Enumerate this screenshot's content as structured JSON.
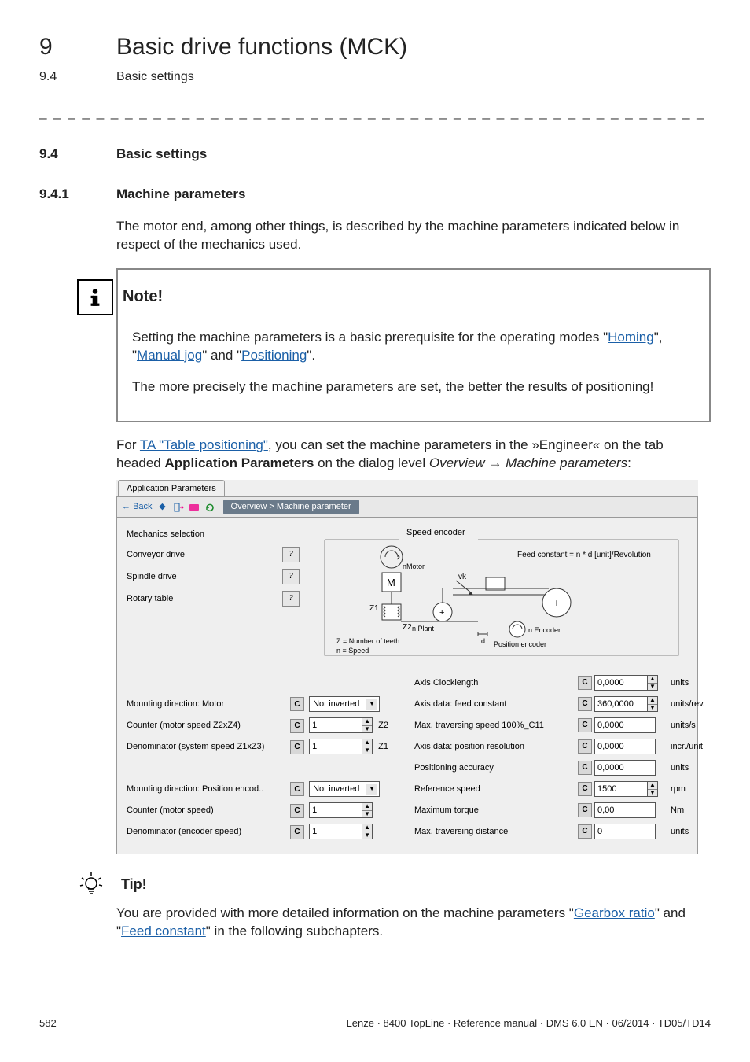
{
  "chapter": {
    "num": "9",
    "title": "Basic drive functions (MCK)"
  },
  "sub": {
    "num": "9.4",
    "title": "Basic settings"
  },
  "dash": "_ _ _ _ _ _ _ _ _ _ _ _ _ _ _ _ _ _ _ _ _ _ _ _ _ _ _ _ _ _ _ _ _ _ _ _ _ _ _ _ _ _ _ _ _ _ _ _ _ _ _ _ _ _ _ _ _ _ _ _ _ _ _ _",
  "sec94": {
    "num": "9.4",
    "title": "Basic settings"
  },
  "sec941": {
    "num": "9.4.1",
    "title": "Machine parameters"
  },
  "intro": "The motor end, among other things, is described by the machine parameters indicated below in respect of the mechanics used.",
  "note": {
    "title": "Note!",
    "line1a": "Setting the machine parameters is a basic prerequisite for the operating modes \"",
    "homing": "Homing",
    "line1b": "\", \"",
    "manualjog": "Manual jog",
    "line1c": "\" and \"",
    "positioning": "Positioning",
    "line1d": "\".",
    "line2": "The more precisely the machine parameters are set, the better the results of positioning!"
  },
  "paraFor_a": "For ",
  "paraFor_link": "TA \"Table positioning\"",
  "paraFor_b": ", you can set the machine parameters in the »Engineer« on the tab headed ",
  "paraFor_bold": "Application Parameters",
  "paraFor_c": " on the dialog level ",
  "paraFor_it1": "Overview",
  "paraFor_arrow": " → ",
  "paraFor_it2": "Machine parameters",
  "paraFor_d": ":",
  "ss": {
    "tab": "Application Parameters",
    "back": "Back",
    "breadcrumb": "Overview > Machine parameter",
    "mech": {
      "heading": "Mechanics selection",
      "conveyor": "Conveyor drive",
      "spindle": "Spindle drive",
      "rotary": "Rotary table",
      "q": "?"
    },
    "diag": {
      "title": "Speed encoder",
      "feed": "Feed constant = n * d [unit]/Revolution",
      "nMotor": "nMotor",
      "nPlant": "n Plant",
      "nEncoder": "n Encoder",
      "Z1": "Z1",
      "Z2": "Z2",
      "vk": "vk",
      "d": "d",
      "zteeth": "Z = Number of teeth",
      "nspeed": "n = Speed",
      "posenc": "Position encoder",
      "M": "M"
    },
    "leftRows": {
      "mdMotor": "Mounting direction: Motor",
      "counterMotor": "Counter (motor speed Z2xZ4)",
      "denomSystem": "Denominator (system speed Z1xZ3)",
      "mdPosEnc": "Mounting direction: Position encod..",
      "counterMotor2": "Counter (motor speed)",
      "denomEnc": "Denominator (encoder speed)",
      "notInverted": "Not inverted",
      "one": "1",
      "Z2": "Z2",
      "Z1": "Z1"
    },
    "rightRows": {
      "axisClocklength": "Axis Clocklength",
      "axisFeed": "Axis data: feed constant",
      "maxTrav100": "Max. traversing speed 100%_C11",
      "axisPosRes": "Axis data: position resolution",
      "posAccuracy": "Positioning accuracy",
      "refSpeed": "Reference speed",
      "maxTorque": "Maximum torque",
      "maxTravDist": "Max. traversing distance",
      "v0": "0,0000",
      "v360": "360,0000",
      "v1500": "1500",
      "v000": "0,00",
      "v0i": "0",
      "units": "units",
      "unitsrev": "units/rev.",
      "unitss": "units/s",
      "incrunit": "incr./unit",
      "rpm": "rpm",
      "Nm": "Nm"
    }
  },
  "tip": {
    "title": "Tip!",
    "a": "You are provided with more detailed information on the machine parameters \"",
    "link1": "Gearbox ratio",
    "b": "\" and \"",
    "link2": "Feed constant",
    "c": "\" in the following subchapters."
  },
  "footer": {
    "page": "582",
    "ref": "Lenze · 8400 TopLine · Reference manual · DMS 6.0 EN · 06/2014 · TD05/TD14"
  }
}
